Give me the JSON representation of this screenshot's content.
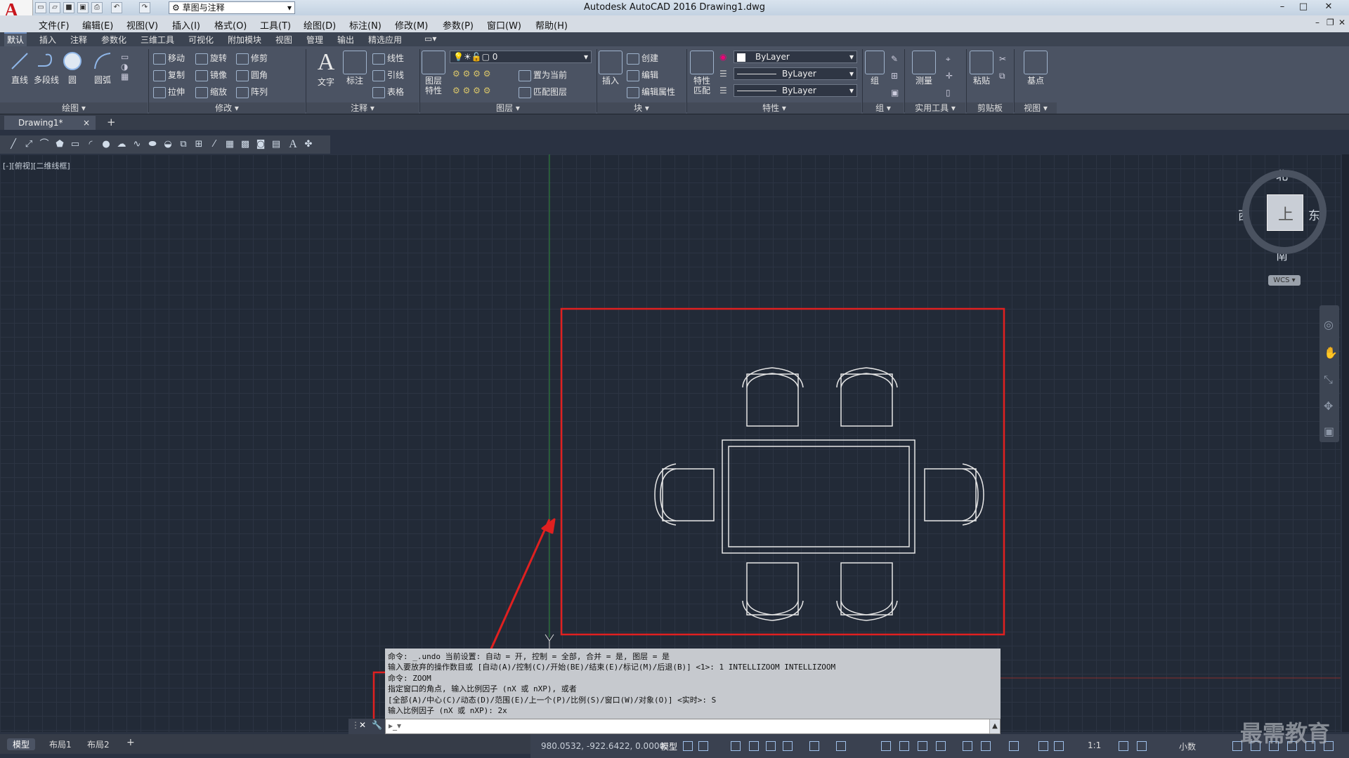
{
  "app": {
    "title": "Autodesk AutoCAD 2016    Drawing1.dwg",
    "logo_letter": "A",
    "workspace": "草图与注释",
    "window_controls": [
      "–",
      "□",
      "✕"
    ]
  },
  "menubar": [
    "文件(F)",
    "编辑(E)",
    "视图(V)",
    "插入(I)",
    "格式(O)",
    "工具(T)",
    "绘图(D)",
    "标注(N)",
    "修改(M)",
    "参数(P)",
    "窗口(W)",
    "帮助(H)"
  ],
  "ribbon_tabs": [
    "默认",
    "插入",
    "注释",
    "参数化",
    "三维工具",
    "可视化",
    "附加模块",
    "视图",
    "管理",
    "输出",
    "精选应用"
  ],
  "ribbon": {
    "draw": {
      "buttons": [
        "直线",
        "多段线",
        "圆",
        "圆弧"
      ],
      "panel": "绘图 ▾"
    },
    "modify": {
      "rows": [
        [
          "移动",
          "旋转",
          "修剪"
        ],
        [
          "复制",
          "镜像",
          "圆角"
        ],
        [
          "拉伸",
          "缩放",
          "阵列"
        ]
      ],
      "panel": "修改 ▾"
    },
    "annotation": {
      "big": [
        "文字",
        "标注"
      ],
      "small": [
        "线性",
        "引线",
        "表格"
      ],
      "panel": "注释 ▾"
    },
    "layers": {
      "big": "图层\n特性",
      "layer_value": "0",
      "small": [
        "置为当前",
        "匹配图层"
      ],
      "panel": "图层 ▾"
    },
    "block": {
      "big": "插入",
      "small": [
        "创建",
        "编辑",
        "编辑属性"
      ],
      "panel": "块 ▾"
    },
    "properties": {
      "big": "特性\n匹配",
      "color": "ByLayer",
      "linetype": "ByLayer",
      "lineweight": "ByLayer",
      "panel": "特性 ▾"
    },
    "groups": {
      "big": "组",
      "panel": "组 ▾"
    },
    "utilities": {
      "big": "测量",
      "panel": "实用工具 ▾"
    },
    "clipboard": {
      "big": "粘贴",
      "panel": "剪贴板"
    },
    "view": {
      "big": "基点",
      "panel": "视图 ▾"
    }
  },
  "doc_tab": "Drawing1*",
  "view_label": "[-][俯视][二维线框]",
  "viewcube": {
    "north": "北",
    "south": "南",
    "east": "东",
    "west": "西",
    "face": "上",
    "wcs": "WCS"
  },
  "command": {
    "history": [
      "命令: _.undo 当前设置: 自动 = 开, 控制 = 全部, 合并 = 是, 图层 = 是",
      "输入要放弃的操作数目或 [自动(A)/控制(C)/开始(BE)/结束(E)/标记(M)/后退(B)] <1>: 1 INTELLIZOOM INTELLIZOOM",
      "命令: ZOOM",
      "指定窗口的角点, 输入比例因子 (nX 或 nXP), 或者",
      "[全部(A)/中心(C)/动态(D)/范围(E)/上一个(P)/比例(S)/窗口(W)/对象(O)] <实时>: S",
      "输入比例因子 (nX 或 nXP): 2x"
    ]
  },
  "layout_tabs": [
    "模型",
    "布局1",
    "布局2",
    "+"
  ],
  "status": {
    "coords": "980.0532, -922.6422, 0.0000",
    "model": "模型",
    "scale": "1:1",
    "units": "小数"
  },
  "watermark": "最需教育",
  "colors": {
    "highlight_red": "#e02020",
    "canvas": "#222a37",
    "drawing_lines": "#e6e6e6"
  }
}
